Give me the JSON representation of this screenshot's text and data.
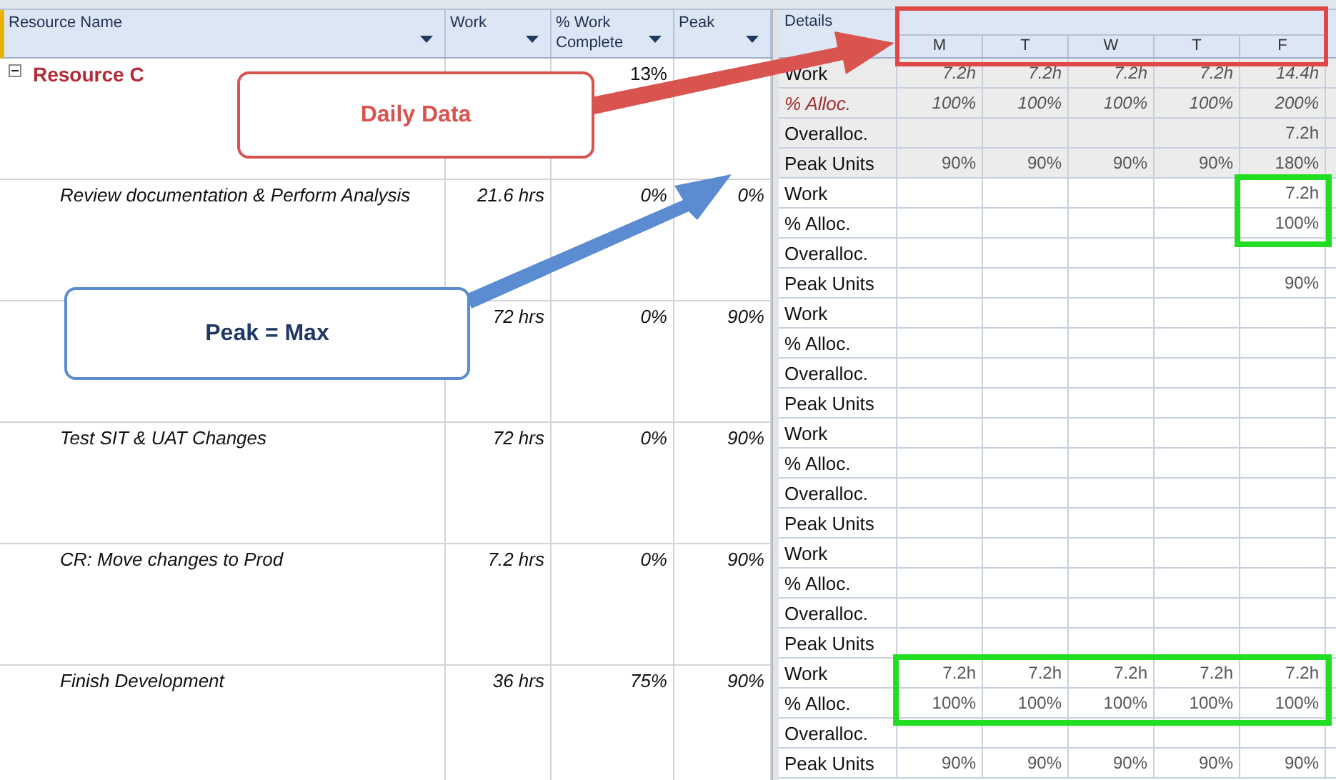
{
  "left_table": {
    "columns": [
      {
        "label": "Resource Name",
        "kind": "name"
      },
      {
        "label": "Work",
        "kind": "work"
      },
      {
        "label": "% Work Complete",
        "kind": "complete"
      },
      {
        "label": "Peak",
        "kind": "peak"
      }
    ]
  },
  "details_header": {
    "label": "Details",
    "days": [
      "M",
      "T",
      "W",
      "T",
      "F"
    ]
  },
  "groups": [
    {
      "kind": "resource",
      "name": "Resource C",
      "expanded": true,
      "complete": "13%",
      "details": [
        {
          "label": "Work",
          "values": {
            "mon": "7.2h",
            "tue": "7.2h",
            "wed": "7.2h",
            "thu": "7.2h",
            "fri": "14.4h"
          }
        },
        {
          "label": "% Alloc.",
          "values": {
            "mon": "100%",
            "tue": "100%",
            "wed": "100%",
            "thu": "100%",
            "fri": "200%"
          }
        },
        {
          "label": "Overalloc.",
          "values": {
            "fri": "7.2h"
          }
        },
        {
          "label": "Peak Units",
          "values": {
            "mon": "90%",
            "tue": "90%",
            "wed": "90%",
            "thu": "90%",
            "fri": "180%"
          }
        }
      ]
    },
    {
      "kind": "task",
      "name": "Review documentation & Perform Analysis",
      "work": "21.6 hrs",
      "complete": "0%",
      "peak": "0%",
      "details": [
        {
          "label": "Work",
          "values": {
            "fri": "7.2h"
          }
        },
        {
          "label": "% Alloc.",
          "values": {
            "fri": "100%"
          }
        },
        {
          "label": "Overalloc."
        },
        {
          "label": "Peak Units",
          "values": {
            "fri": "90%"
          }
        }
      ]
    },
    {
      "kind": "task",
      "work": "72 hrs",
      "complete": "0%",
      "peak": "90%",
      "details": [
        {
          "label": "Work"
        },
        {
          "label": "% Alloc."
        },
        {
          "label": "Overalloc."
        },
        {
          "label": "Peak Units"
        }
      ]
    },
    {
      "kind": "task",
      "name": "Test SIT & UAT Changes",
      "work": "72 hrs",
      "complete": "0%",
      "peak": "90%",
      "details": [
        {
          "label": "Work"
        },
        {
          "label": "% Alloc."
        },
        {
          "label": "Overalloc."
        },
        {
          "label": "Peak Units"
        }
      ]
    },
    {
      "kind": "task",
      "name": "CR: Move changes to Prod",
      "work": "7.2 hrs",
      "complete": "0%",
      "peak": "90%",
      "details": [
        {
          "label": "Work"
        },
        {
          "label": "% Alloc."
        },
        {
          "label": "Overalloc."
        },
        {
          "label": "Peak Units"
        }
      ]
    },
    {
      "kind": "task",
      "name": "Finish Development",
      "work": "36 hrs",
      "complete": "75%",
      "peak": "90%",
      "details": [
        {
          "label": "Work",
          "values": {
            "mon": "7.2h",
            "tue": "7.2h",
            "wed": "7.2h",
            "thu": "7.2h",
            "fri": "7.2h"
          }
        },
        {
          "label": "% Alloc.",
          "values": {
            "mon": "100%",
            "tue": "100%",
            "wed": "100%",
            "thu": "100%",
            "fri": "100%"
          }
        },
        {
          "label": "Overalloc."
        },
        {
          "label": "Peak Units",
          "values": {
            "mon": "90%",
            "tue": "90%",
            "wed": "90%",
            "thu": "90%",
            "fri": "90%"
          }
        }
      ]
    }
  ],
  "callouts": [
    {
      "kind": "daily",
      "text": "Daily Data",
      "color": "#d9534f"
    },
    {
      "kind": "peak",
      "text": "Peak = Max",
      "color": "#5b8bd0"
    }
  ]
}
